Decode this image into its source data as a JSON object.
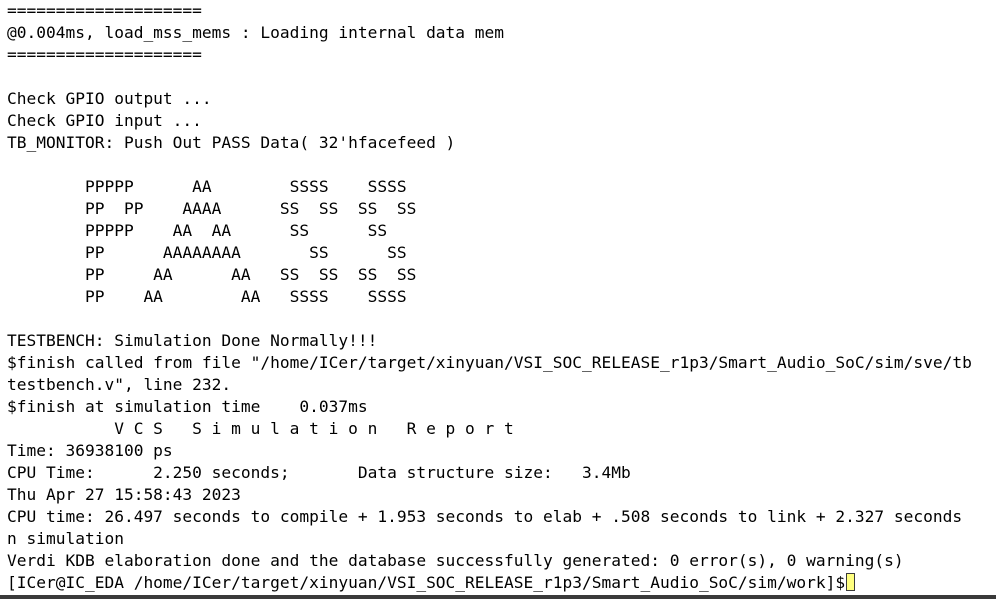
{
  "terminal": {
    "lines": [
      "====================",
      "@0.004ms, load_mss_mems : Loading internal data mem",
      "====================",
      "",
      "Check GPIO output ...",
      "Check GPIO input ...",
      "TB_MONITOR: Push Out PASS Data( 32'hfacefeed )",
      "",
      "        PPPPP      AA        SSSS    SSSS",
      "        PP  PP    AAAA      SS  SS  SS  SS",
      "        PPPPP    AA  AA      SS      SS",
      "        PP      AAAAAAAA       SS      SS",
      "        PP     AA      AA   SS  SS  SS  SS",
      "        PP    AA        AA   SSSS    SSSS",
      "",
      "TESTBENCH: Simulation Done Normally!!!",
      "$finish called from file \"/home/ICer/target/xinyuan/VSI_SOC_RELEASE_r1p3/Smart_Audio_SoC/sim/sve/tb",
      "testbench.v\", line 232.",
      "$finish at simulation time    0.037ms",
      "           V C S   S i m u l a t i o n   R e p o r t",
      "Time: 36938100 ps",
      "CPU Time:      2.250 seconds;       Data structure size:   3.4Mb",
      "Thu Apr 27 15:58:43 2023",
      "CPU time: 26.497 seconds to compile + 1.953 seconds to elab + .508 seconds to link + 2.327 seconds",
      "n simulation",
      "Verdi KDB elaboration done and the database successfully generated: 0 error(s), 0 warning(s)"
    ],
    "prompt": "[ICer@IC_EDA /home/ICer/target/xinyuan/VSI_SOC_RELEASE_r1p3/Smart_Audio_SoC/sim/work]$"
  }
}
